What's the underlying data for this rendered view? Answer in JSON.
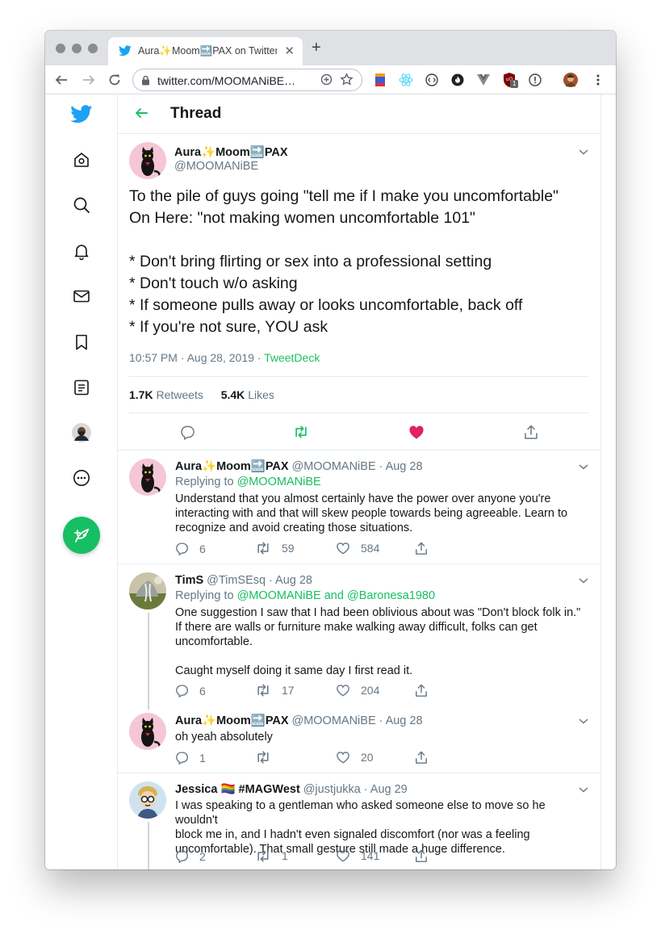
{
  "browser": {
    "tab_title": "Aura✨Moom🔜PAX on Twitter",
    "url": "twitter.com/MOOMANiBE…",
    "extension_badge": "1"
  },
  "page": {
    "header_title": "Thread"
  },
  "main_tweet": {
    "display_name": "Aura✨Moom🔜PAX",
    "handle": "@MOOMANiBE",
    "text": "To the pile of guys going \"tell me if I make you uncomfortable\"\nOn Here: \"not making women uncomfortable 101\"\n\n* Don't bring flirting or sex into a professional setting\n* Don't touch w/o asking\n* If someone pulls away or looks uncomfortable, back off\n* If you're not sure, YOU ask",
    "time": "10:57 PM · Aug 28, 2019 · ",
    "source": "TweetDeck",
    "retweets_count": "1.7K",
    "retweets_label": "Retweets",
    "likes_count": "5.4K",
    "likes_label": "Likes"
  },
  "replies": [
    {
      "display_name": "Aura✨Moom🔜PAX",
      "handle": "@MOOMANiBE",
      "date": "· Aug 28",
      "replying_label": "Replying to ",
      "replying_to": "@MOOMANiBE",
      "text": "Understand that you almost certainly have the power over anyone you're\ninteracting with and that will skew people towards being agreeable. Learn to\nrecognize and avoid creating those situations.",
      "replies": "6",
      "retweets": "59",
      "likes": "584"
    },
    {
      "display_name": "TimS",
      "handle": "@TimSEsq",
      "date": "· Aug 28",
      "replying_label": "Replying to ",
      "replying_to": "@MOOMANiBE and @Baronesa1980",
      "text": "One suggestion I saw that I had been oblivious about was \"Don't block folk in.\"\nIf there are walls or furniture make walking away difficult, folks can get\nuncomfortable.\n\nCaught myself doing it same day I first read it.",
      "replies": "6",
      "retweets": "17",
      "likes": "204"
    },
    {
      "display_name": "Aura✨Moom🔜PAX",
      "handle": "@MOOMANiBE",
      "date": "· Aug 28",
      "text": "oh yeah absolutely",
      "replies": "1",
      "retweets": "",
      "likes": "20"
    },
    {
      "display_name": "Jessica 🏳️‍🌈 #MAGWest",
      "handle": "@justjukka",
      "date": "· Aug 29",
      "text": "I was speaking to a gentleman who asked someone else to move so he wouldn't\nblock me in, and I hadn't even signaled discomfort (nor was a feeling\nuncomfortable). That small gesture still made a huge difference.",
      "replies": "2",
      "retweets": "1",
      "likes": "141"
    }
  ],
  "colors": {
    "accent": "#17bf63",
    "twitter_blue": "#1da1f2",
    "like_red": "#e0245e",
    "muted": "#657786"
  }
}
